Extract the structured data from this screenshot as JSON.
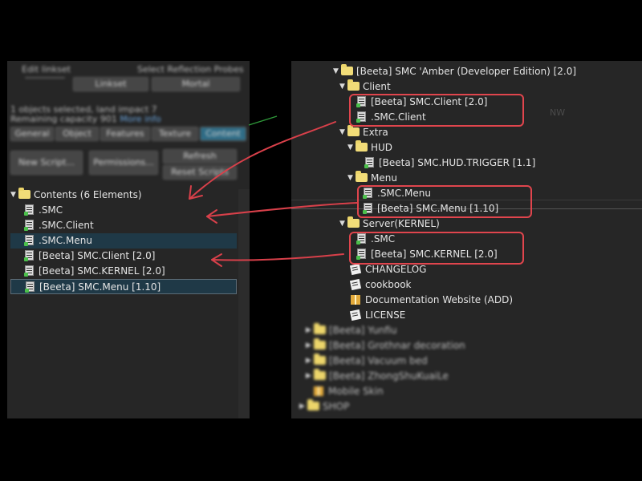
{
  "left_panel": {
    "blurred_header": {
      "title_left": "Edit linkset",
      "title_right": "Select Reflection Probes",
      "sel_field_1": "",
      "sel_field_2": "Linkset",
      "sel_field_3": "Mortal",
      "objects_selected": "1 objects selected, land impact 7",
      "remaining_capacity": "Remaining capacity 901",
      "help_link": "More info",
      "tabs": [
        "General",
        "Object",
        "Features",
        "Texture",
        "Content"
      ],
      "buttons": [
        "New Script...",
        "Permissions...",
        "Refresh",
        "Reset Scripts"
      ]
    },
    "contents": {
      "header": "Contents (6 Elements)",
      "items": [
        {
          "label": ".SMC",
          "icon": "script-icon"
        },
        {
          "label": ".SMC.Client",
          "icon": "script-icon"
        },
        {
          "label": ".SMC.Menu",
          "icon": "script-icon"
        },
        {
          "label": "[Beeta] SMC.Client [2.0]",
          "icon": "script-icon"
        },
        {
          "label": "[Beeta] SMC.KERNEL [2.0]",
          "icon": "script-icon"
        },
        {
          "label": "[Beeta] SMC.Menu [1.10]",
          "icon": "script-icon"
        }
      ]
    }
  },
  "right_panel": {
    "root": "[Beeta] SMC 'Amber (Developer Edition) [2.0]",
    "client_folder": "Client",
    "client_items": [
      "[Beeta] SMC.Client [2.0]",
      ".SMC.Client"
    ],
    "extra_folder": "Extra",
    "hud_folder": "HUD",
    "hud_items": [
      "[Beeta] SMC.HUD.TRIGGER [1.1]"
    ],
    "menu_folder": "Menu",
    "menu_items": [
      ".SMC.Menu",
      "[Beeta] SMC.Menu [1.10]"
    ],
    "server_folder": "Server(KERNEL)",
    "server_items": [
      ".SMC",
      "[Beeta] SMC.KERNEL [2.0]"
    ],
    "root_files": [
      {
        "label": "CHANGELOG",
        "icon": "note-icon"
      },
      {
        "label": "cookbook",
        "icon": "note-icon"
      },
      {
        "label": "Documentation Website (ADD)",
        "icon": "box-icon"
      },
      {
        "label": "LICENSE",
        "icon": "note-icon"
      }
    ],
    "blurred_folders": [
      "[Beeta] Yunfiu",
      "[Beeta] Grothnar decoration",
      "[Beeta] Vacuum bed",
      "[Beeta] ZhongShuKuaiLe",
      "Mobile Skin",
      "SHOP"
    ],
    "map_label": "NW"
  },
  "colors": {
    "highlight": "#e0454d",
    "selection": "#1f3947",
    "panel_bg": "#262626"
  }
}
